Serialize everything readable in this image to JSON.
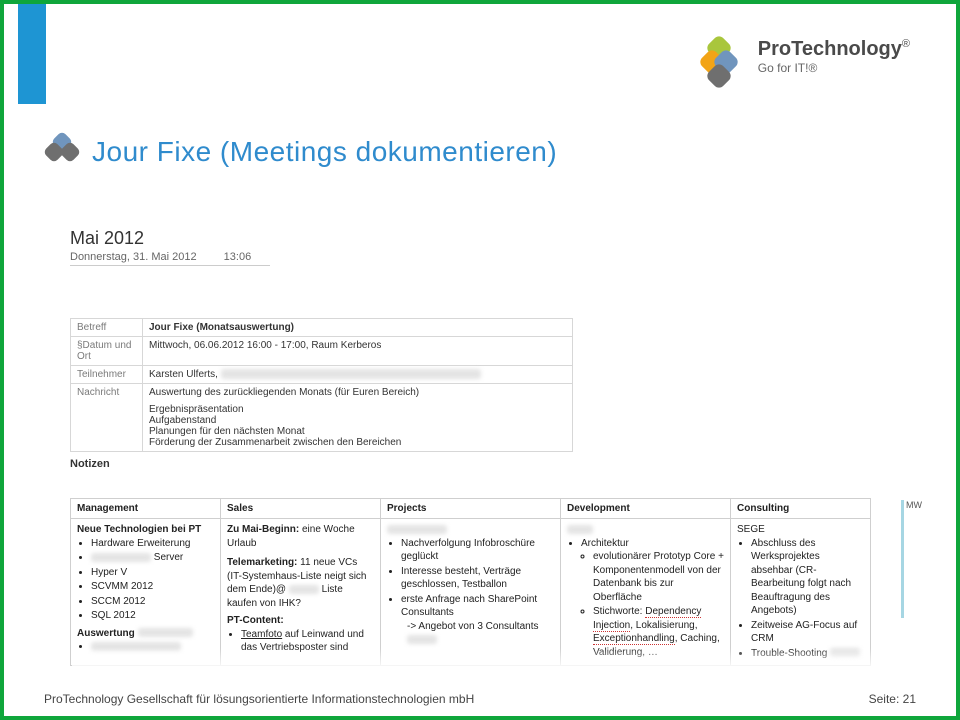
{
  "brand": {
    "name": "ProTechnology",
    "registered": "®",
    "slogan": "Go for IT!®"
  },
  "slide": {
    "title": "Jour Fixe (Meetings dokumentieren)"
  },
  "note": {
    "title": "Mai 2012",
    "date": "Donnerstag, 31. Mai 2012",
    "time": "13:06"
  },
  "meeting": {
    "labels": {
      "subject": "Betreff",
      "datePlace": "§Datum und Ort",
      "participants": "Teilnehmer",
      "message": "Nachricht"
    },
    "subject": "Jour Fixe (Monatsauswertung)",
    "datePlace": "Mittwoch, 06.06.2012 16:00 - 17:00, Raum Kerberos",
    "participants": "Karsten Ulferts,",
    "message": {
      "l1": "Auswertung des zurückliegenden Monats (für Euren Bereich)",
      "l2": "Ergebnispräsentation",
      "l3": "Aufgabenstand",
      "l4": "Planungen für den nächsten Monat",
      "l5": "Förderung der Zusammenarbeit zwischen den Bereichen"
    }
  },
  "notesHeading": "Notizen",
  "columns": {
    "management": {
      "header": "Management",
      "title": "Neue Technologien bei PT",
      "b1": "Hardware Erweiterung",
      "b2_suffix": "Server",
      "b3": "Hyper V",
      "b4": "SCVMM 2012",
      "b5": "SCCM 2012",
      "b6": "SQL 2012",
      "sub": "Auswertung"
    },
    "sales": {
      "header": "Sales",
      "l1_label": "Zu Mai-Beginn:",
      "l1_text": " eine Woche Urlaub",
      "l2_label": "Telemarketing:",
      "l2_text": " 11 neue VCs (IT-Systemhaus-Liste neigt sich dem Ende)@ ",
      "l2_tail": " Liste kaufen von IHK?",
      "sub": "PT-Content:",
      "b1_u": "Teamfoto",
      "b1_tail": " auf Leinwand und das Vertriebsposter sind"
    },
    "projects": {
      "header": "Projects",
      "b1": "Nachverfolgung Infobroschüre geglückt",
      "b2": "Interesse besteht, Verträge geschlossen, Testballon",
      "b3": "erste Anfrage nach SharePoint Consultants",
      "b3a": "-> Angebot von 3 Consultants"
    },
    "development": {
      "header": "Development",
      "b1": "Architektur",
      "b1a_pre": "evolutionärer Prototyp Core + Komponentenmodell von der Datenbank bis zur Oberfläche",
      "b1b_pre": "Stichworte: ",
      "b1b_u1": "Dependency Injection",
      "b1b_mid": ", Lokalisierung, ",
      "b1b_u2": "Exceptionhandling",
      "b1b_tail": ", Caching, Validierung, …"
    },
    "consulting": {
      "header": "Consulting",
      "title": "SEGE",
      "b1": "Abschluss des Werksprojektes absehbar (CR-Bearbeitung folgt nach Beauftragung des Angebots)",
      "b2": "Zeitweise AG-Focus auf CRM",
      "b3": "Trouble-Shooting"
    }
  },
  "sideMark": "MW",
  "footer": {
    "company": "ProTechnology Gesellschaft für lösungsorientierte Informationstechnologien mbH",
    "pageLabel": "Seite: ",
    "pageNum": "21"
  }
}
